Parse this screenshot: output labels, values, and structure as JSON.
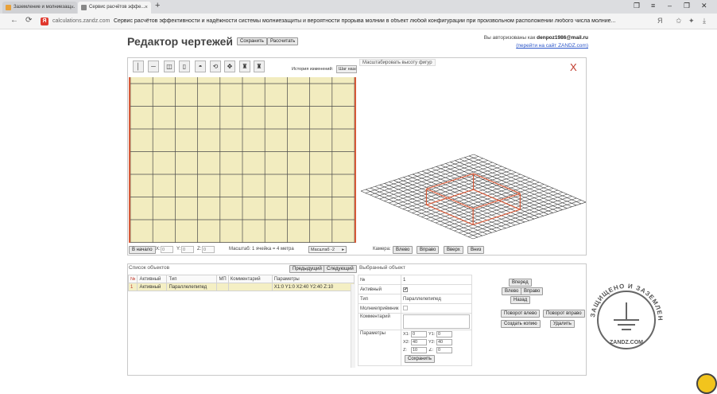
{
  "browser": {
    "tabs": [
      {
        "title": "Заземление и молниезащ...",
        "favicon_color": "#e8a13a"
      },
      {
        "title": "Сервис расчётов эффе...",
        "favicon_color": "#888888"
      }
    ],
    "url": "calculations.zandz.com",
    "page_title": "Сервис расчётов эффективности и надёжности системы молниезащиты и вероятности прорыва молнии в объект любой конфигурации при произвольном расположении любого числа молние...",
    "favicon_letter": "Я"
  },
  "page": {
    "title": "Редактор чертежей",
    "save_label": "Сохранить",
    "calculate_label": "Рассчитать",
    "auth_text": "Вы авторизованы как",
    "auth_user": "denpoz1986@mail.ru",
    "goto_site": "(перейти на сайт ZANDZ.com)"
  },
  "editor": {
    "history_label": "История изменений:",
    "history_button": "Шаг назад",
    "scale_figures_label": "Масштабировать высоту фигур",
    "close_label": "X",
    "to_start_button": "В начало",
    "x_label": "X:",
    "x_value": "0",
    "y_label": "Y:",
    "y_value": "0",
    "z_label": "Z:",
    "z_value": "0",
    "scale_text": "Масштаб: 1 ячейка = 4 метра",
    "scale_select": "Масштаб -2",
    "camera_label": "Камера:",
    "camera_buttons": [
      "Влево",
      "Вправо",
      "Вверх",
      "Вниз"
    ],
    "tools": [
      {
        "name": "vertical-line-icon",
        "glyph": "│"
      },
      {
        "name": "horizontal-line-icon",
        "glyph": "─"
      },
      {
        "name": "box-icon",
        "glyph": "◫"
      },
      {
        "name": "cylinder-icon",
        "glyph": "▯"
      },
      {
        "name": "dome-icon",
        "glyph": "◓"
      },
      {
        "name": "rotate-icon",
        "glyph": "⟲"
      },
      {
        "name": "move-icon",
        "glyph": "✥"
      },
      {
        "name": "mast-icon",
        "glyph": "♜"
      },
      {
        "name": "mast-pair-icon",
        "glyph": "♜"
      }
    ],
    "grid_color": "#f2ecbf",
    "accent_color": "#d65a39"
  },
  "objects": {
    "list_title": "Список объектов",
    "prev_button": "Предыдущий",
    "next_button": "Следующий",
    "selected_title": "Выбранный объект",
    "columns": [
      "№",
      "Активный",
      "Тип",
      "МП",
      "Комментарий",
      "Параметры"
    ],
    "rows": [
      {
        "num": "1",
        "active": "Активный",
        "type": "Параллелепипед",
        "mp": "",
        "comment": "",
        "params": "X1:0 Y1:0 X2:40 Y2:40 Z:10"
      }
    ]
  },
  "selected": {
    "num_label": "№",
    "num_value": "1",
    "active_label": "Активный",
    "active_checked": "✔",
    "type_label": "Тип",
    "type_value": "Параллелепипед",
    "lightning_label": "Молниеприёмник",
    "comment_label": "Комментарий",
    "params_label": "Параметры",
    "x1_label": "X1:",
    "x1_value": "0",
    "y1_label": "Y1:",
    "y1_value": "0",
    "x2_label": "X2:",
    "x2_value": "40",
    "y2_label": "Y2:",
    "y2_value": "40",
    "z_label": "Z:",
    "z_value": "10",
    "angle_label": "∠:",
    "angle_value": "0",
    "save_label": "Сохранить"
  },
  "actions": {
    "forward": "Вперед",
    "left": "Влево",
    "right": "Вправо",
    "back": "Назад",
    "rotate_left": "Поворот влево",
    "rotate_right": "Поворот вправо",
    "copy": "Создать копию",
    "delete": "Удалить"
  },
  "watermark": {
    "arc_text": "ЗАЩИЩЕНО И ЗАЗЕМЛЕНО",
    "site": "ZANDZ.COM"
  }
}
